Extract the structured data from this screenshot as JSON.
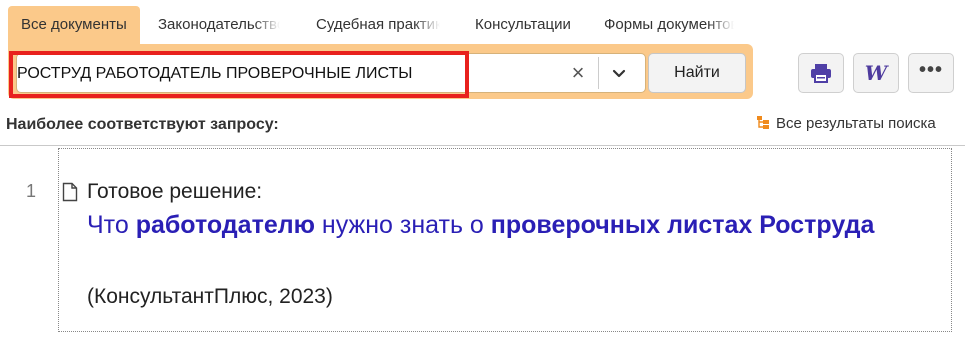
{
  "tabs": [
    {
      "label": "Все документы",
      "active": true
    },
    {
      "label": "Законодательство"
    },
    {
      "label": "Судебная практика"
    },
    {
      "label": "Консультации"
    },
    {
      "label": "Формы документов"
    }
  ],
  "search": {
    "value": "РОСТРУД РАБОТОДАТЕЛЬ ПРОВЕРОЧНЫЕ ЛИСТЫ",
    "clear_symbol": "×",
    "find_label": "Найти"
  },
  "toolbar": {
    "print_icon": "printer-icon",
    "word_icon": "word-export-icon",
    "word_letter": "W",
    "more_icon": "more-dots-icon",
    "more_symbol": "•••"
  },
  "results": {
    "header": "Наиболее соответствуют запросу:",
    "all_results_link": "Все результаты поиска",
    "items": [
      {
        "number": "1",
        "type": "Готовое решение:",
        "title_parts": [
          {
            "text": "Что ",
            "bold": false
          },
          {
            "text": "работодателю",
            "bold": true
          },
          {
            "text": " нужно знать о ",
            "bold": false
          },
          {
            "text": "проверочных листах Роструда",
            "bold": true
          }
        ],
        "source": "(КонсультантПлюс, 2023)"
      }
    ]
  },
  "colors": {
    "accent_orange": "#fbc98a",
    "highlight_red": "#e8211d",
    "link_blue": "#2a1fb5"
  }
}
